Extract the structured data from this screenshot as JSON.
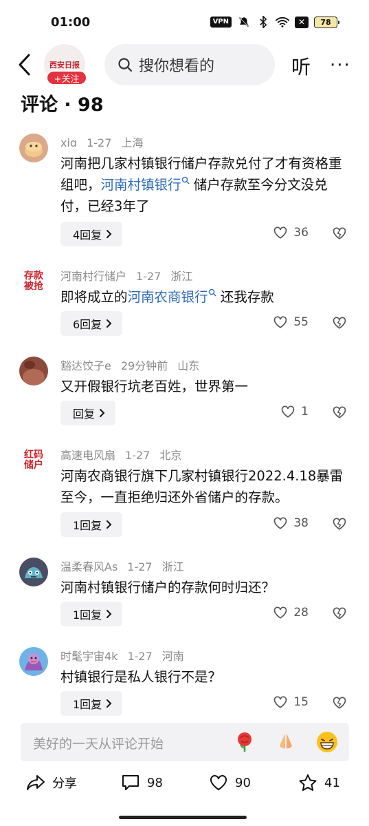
{
  "status_bar": {
    "time": "01:00",
    "vpn": "VPN",
    "battery": "78"
  },
  "header": {
    "account_logo_text": "西安日报",
    "follow_label": "+关注",
    "search_placeholder": "搜你想看的",
    "listen_label": "听",
    "more_label": "···"
  },
  "title": "评论 · 98",
  "comments": [
    {
      "user": "xiɑ",
      "date": "1-27",
      "location": "上海",
      "text_before": "河南把几家村镇银行储户存款兑付了才有资格重组吧，",
      "link": "河南村镇银行",
      "text_after": " 储户存款至今分文没兑付，已经3年了",
      "replies": "4回复",
      "likes": "36",
      "avatar": "pancake"
    },
    {
      "user": "河南村行储户",
      "date": "1-27",
      "location": "浙江",
      "text_before": "即将成立的",
      "link": "河南农商银行",
      "text_after": " 还我存款",
      "replies": "6回复",
      "likes": "55",
      "avatar": "text",
      "avatar_text": "存款被抢"
    },
    {
      "user": "豁达饺子e",
      "date": "29分钟前",
      "location": "山东",
      "text_before": "又开假银行坑老百姓，世界第一",
      "link": "",
      "text_after": "",
      "replies": "回复",
      "likes": "1",
      "avatar": "photo"
    },
    {
      "user": "高速电风扇",
      "date": "1-27",
      "location": "北京",
      "text_before": "河南农商银行旗下几家村镇银行2022.4.18暴雷至今，一直拒绝归还外省储户的存款。",
      "link": "",
      "text_after": "",
      "replies": "1回复",
      "likes": "38",
      "avatar": "text",
      "avatar_text": "红码储户"
    },
    {
      "user": "温柔春风As",
      "date": "1-27",
      "location": "浙江",
      "text_before": "河南村镇银行储户的存款何时归还？",
      "link": "",
      "text_after": "",
      "replies": "1回复",
      "likes": "28",
      "avatar": "monster"
    },
    {
      "user": "时髦宇宙4k",
      "date": "1-27",
      "location": "河南",
      "text_before": "村镇银行是私人银行不是？",
      "link": "",
      "text_after": "",
      "replies": "1回复",
      "likes": "15",
      "avatar": "cartoon"
    }
  ],
  "input": {
    "placeholder": "美好的一天从评论开始",
    "emojis": [
      "rose-emoji",
      "pray-emoji",
      "grin-emoji"
    ]
  },
  "bottom_bar": {
    "share_label": "分享",
    "comments_count": "98",
    "likes_count": "90",
    "favorites_count": "41"
  },
  "colors": {
    "accent_red": "#e6323e",
    "link_blue": "#2e6bb6",
    "meta_gray": "#8a8a8a"
  }
}
